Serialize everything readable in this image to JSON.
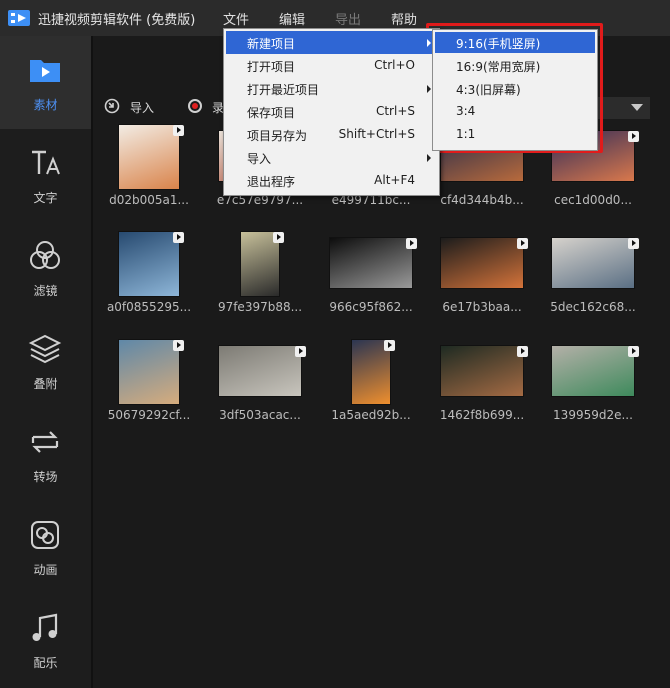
{
  "app": {
    "title": "迅捷视频剪辑软件 (免费版)"
  },
  "menubar": {
    "file": "文件",
    "edit": "编辑",
    "export": "导出",
    "help": "帮助"
  },
  "sidebar": {
    "items": [
      {
        "label": "素材",
        "icon": "folder-icon",
        "active": true
      },
      {
        "label": "文字",
        "icon": "text-icon"
      },
      {
        "label": "滤镜",
        "icon": "filter-icon"
      },
      {
        "label": "叠附",
        "icon": "layers-icon"
      },
      {
        "label": "转场",
        "icon": "transition-icon"
      },
      {
        "label": "动画",
        "icon": "animation-icon"
      },
      {
        "label": "配乐",
        "icon": "music-icon"
      }
    ]
  },
  "toolbar": {
    "import_label": "导入",
    "record_label": "录"
  },
  "media": [
    {
      "name": "d02b005a1...",
      "colors": [
        "#f2ece4",
        "#d9834a"
      ]
    },
    {
      "name": "e7c57e9797...",
      "colors": [
        "#e9e1d8",
        "#b45b45"
      ]
    },
    {
      "name": "e499711bc...",
      "colors": [
        "#2b2b2b",
        "#666"
      ]
    },
    {
      "name": "cf4d344b4b...",
      "colors": [
        "#2a2d4a",
        "#b86a3c"
      ]
    },
    {
      "name": "cec1d00d0...",
      "colors": [
        "#322c58",
        "#d9784c"
      ]
    },
    {
      "name": "a0f0855295...",
      "colors": [
        "#274a70",
        "#8eb6d8"
      ]
    },
    {
      "name": "97fe397b88...",
      "colors": [
        "#c7c09a",
        "#2a2a2a"
      ]
    },
    {
      "name": "966c95f862...",
      "colors": [
        "#0d0d0d",
        "#9a9a9a"
      ]
    },
    {
      "name": "6e17b3baa...",
      "colors": [
        "#1c1c1c",
        "#d4733a"
      ]
    },
    {
      "name": "5dec162c68...",
      "colors": [
        "#d6d2cc",
        "#5a6f84"
      ]
    },
    {
      "name": "50679292cf...",
      "colors": [
        "#5f88a8",
        "#d6ac7d"
      ]
    },
    {
      "name": "3df503acac...",
      "colors": [
        "#7d7b74",
        "#c8c5bd"
      ]
    },
    {
      "name": "1a5aed92b...",
      "colors": [
        "#2b3552",
        "#ef8f2e"
      ]
    },
    {
      "name": "1462f8b699...",
      "colors": [
        "#1e2a22",
        "#a56b44"
      ]
    },
    {
      "name": "139959d2e...",
      "colors": [
        "#b4b0a8",
        "#3e8a5c"
      ]
    }
  ],
  "file_menu": {
    "items": [
      {
        "label": "新建项目",
        "shortcut": "",
        "submenu": true,
        "selected": true
      },
      {
        "label": "打开项目",
        "shortcut": "Ctrl+O"
      },
      {
        "label": "打开最近项目",
        "shortcut": "",
        "submenu": true
      },
      {
        "label": "保存项目",
        "shortcut": "Ctrl+S"
      },
      {
        "label": "项目另存为",
        "shortcut": "Shift+Ctrl+S"
      },
      {
        "label": "导入",
        "shortcut": "",
        "submenu": true
      },
      {
        "label": "退出程序",
        "shortcut": "Alt+F4"
      }
    ]
  },
  "new_project_submenu": {
    "items": [
      {
        "label": "9:16(手机竖屏)",
        "selected": true
      },
      {
        "label": "16:9(常用宽屏)"
      },
      {
        "label": "4:3(旧屏幕)"
      },
      {
        "label": "3:4"
      },
      {
        "label": "1:1"
      }
    ]
  },
  "colors": {
    "accent": "#2f66d4",
    "active_label": "#4d8ff0",
    "highlight": "#e11b1b"
  }
}
